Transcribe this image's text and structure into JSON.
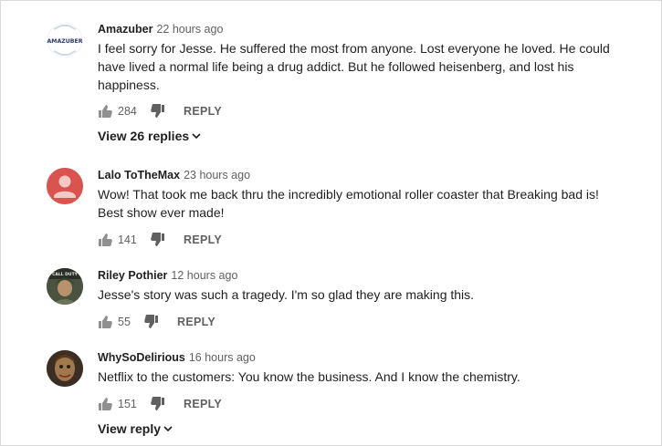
{
  "comments": [
    {
      "author": "Amazuber",
      "time": "22 hours ago",
      "text": "I feel sorry for Jesse. He suffered the most from anyone. Lost everyone he loved. He could have lived a normal life being a drug addict. But he followed heisenberg, and lost his happiness.",
      "likes": "284",
      "reply_label": "REPLY",
      "view_replies": "View 26 replies",
      "avatar_text": "AMAZUBER"
    },
    {
      "author": "Lalo ToTheMax",
      "time": "23 hours ago",
      "text": "Wow! That took me back thru the incredibly emotional roller coaster that Breaking bad is! Best show ever made!",
      "likes": "141",
      "reply_label": "REPLY"
    },
    {
      "author": "Riley Pothier",
      "time": "12 hours ago",
      "text": "Jesse's story was such a tragedy. I'm so glad they are making this.",
      "likes": "55",
      "reply_label": "REPLY"
    },
    {
      "author": "WhySoDelirious",
      "time": "16 hours ago",
      "text": "Netflix to the customers: You know the business. And I know the chemistry.",
      "likes": "151",
      "reply_label": "REPLY",
      "view_replies": "View reply"
    }
  ],
  "colors": {
    "text": "#1f1f1f",
    "meta": "#606060",
    "avatar_red": "#d9534f"
  },
  "icons": {
    "like": "thumbs-up-icon",
    "dislike": "thumbs-down-icon",
    "expand": "chevron-down-icon"
  }
}
